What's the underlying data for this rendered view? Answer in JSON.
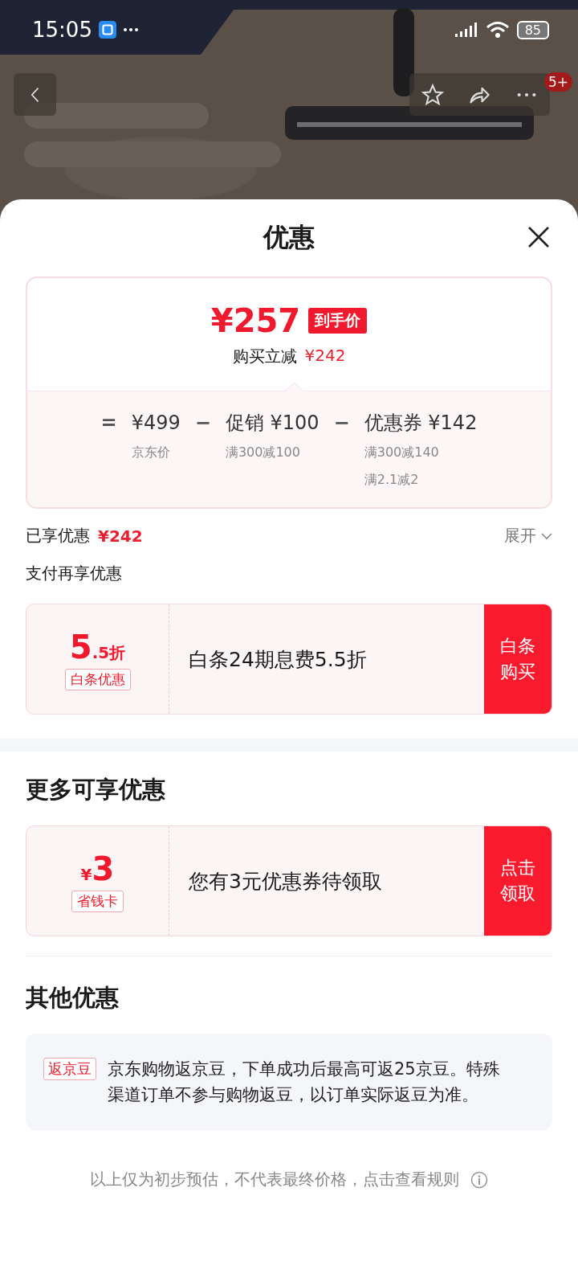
{
  "status_bar": {
    "time": "15:05",
    "battery": "85"
  },
  "product_header": {
    "kind": "picture",
    "more_badge": "5+"
  },
  "sheet": {
    "title": "优惠"
  },
  "price_summary": {
    "final_price": "¥257",
    "final_price_tag": "到手价",
    "saving_label": "购买立减",
    "saving_amount": "¥242",
    "breakdown": [
      {
        "operator": "=",
        "title": "¥499",
        "notes": [
          "京东价"
        ]
      },
      {
        "operator": "−",
        "title": "促销 ¥100",
        "notes": [
          "满300减100"
        ]
      },
      {
        "operator": "−",
        "title": "优惠券 ¥142",
        "notes": [
          "满300减140",
          "满2.1减2"
        ]
      }
    ]
  },
  "enjoyed": {
    "label": "已享优惠",
    "amount": "¥242",
    "expand": "展开"
  },
  "pay_section": {
    "title": "支付再享优惠",
    "offers": [
      {
        "value": "5",
        "value_suffix": ".5折",
        "tag": "白条优惠",
        "text": "白条24期息费5.5折",
        "action": "白条购买"
      }
    ]
  },
  "more_section": {
    "title": "更多可享优惠",
    "offers": [
      {
        "value_prefix": "¥",
        "value": "3",
        "tag": "省钱卡",
        "text": "您有3元优惠券待领取",
        "action": "点击领取"
      }
    ]
  },
  "other_section": {
    "title": "其他优惠",
    "items": [
      {
        "tag": "返京豆",
        "text": "京东购物返京豆，下单成功后最高可返25京豆。特殊渠道订单不参与购物返豆，以订单实际返豆为准。"
      }
    ]
  },
  "footer": {
    "note": "以上仅为初步预估，不代表最终价格，点击查看规则"
  }
}
